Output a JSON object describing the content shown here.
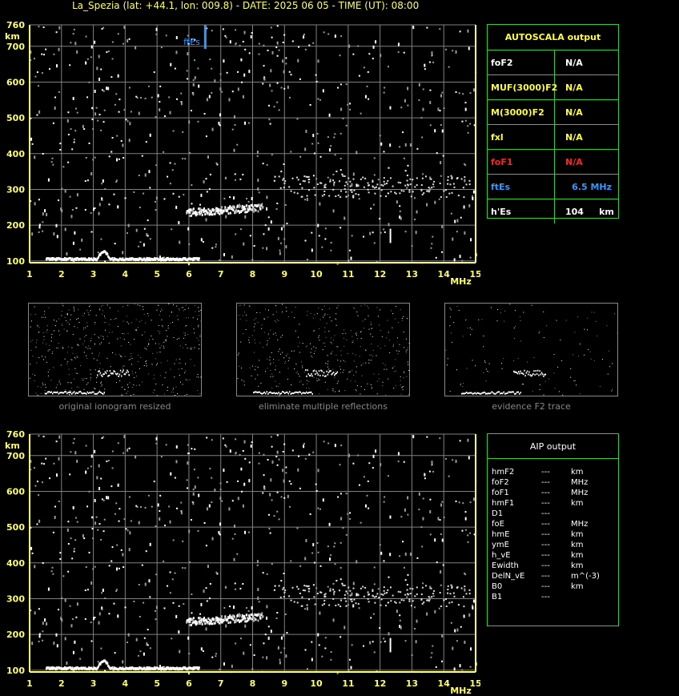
{
  "header": {
    "title": "La_Spezia (lat: +44.1, lon: 009.8) - DATE: 2025 06 05 - TIME (UT): 08:00"
  },
  "colors": {
    "axis": "#ffff66",
    "grid": "#808080",
    "panel_border": "#33cc33",
    "label_yellow": "#ffff33",
    "foF1_red": "#ff2222",
    "ftEs_blue": "#3399ff"
  },
  "chart_data": [
    {
      "type": "scatter",
      "name_hint": "main ionogram",
      "xlabel": "MHz",
      "ylabel": "km",
      "xlim": [
        1,
        15
      ],
      "ylim": [
        95,
        760
      ],
      "x_ticks": [
        1,
        2,
        3,
        4,
        5,
        6,
        7,
        8,
        9,
        10,
        11,
        12,
        13,
        14,
        15
      ],
      "y_ticks": [
        100,
        200,
        300,
        400,
        500,
        600,
        700,
        760
      ],
      "annotation": {
        "label": "ftEs",
        "x": 6.5
      },
      "traces": [
        {
          "id": "E-layer trace",
          "x_range": [
            1.5,
            6.3
          ],
          "y": 105
        },
        {
          "id": "F-layer trace",
          "x_range": [
            5.9,
            8.3
          ],
          "y": 235
        },
        {
          "id": "scattered high echoes",
          "x_range": [
            8.8,
            14.8
          ],
          "y": 310
        }
      ]
    },
    {
      "type": "scatter",
      "name_hint": "bottom ionogram",
      "xlabel": "MHz",
      "ylabel": "km",
      "xlim": [
        1,
        15
      ],
      "ylim": [
        95,
        760
      ],
      "x_ticks": [
        1,
        2,
        3,
        4,
        5,
        6,
        7,
        8,
        9,
        10,
        11,
        12,
        13,
        14,
        15
      ],
      "y_ticks": [
        100,
        200,
        300,
        400,
        500,
        600,
        700,
        760
      ]
    }
  ],
  "autoscala": {
    "title": "AUTOSCALA output",
    "rows": [
      {
        "label": "foF2",
        "value": "N/A"
      },
      {
        "label": "MUF(3000)F2",
        "value": "N/A"
      },
      {
        "label": "M(3000)F2",
        "value": "N/A"
      },
      {
        "label": "fxl",
        "value": "N/A"
      },
      {
        "label": "foF1",
        "value": "N/A"
      },
      {
        "label": "ftEs",
        "value": "6.5 MHz"
      },
      {
        "label": "h'Es",
        "value": "104     km"
      }
    ]
  },
  "thumbnails": [
    {
      "caption": "original ionogram resized"
    },
    {
      "caption": "eliminate multiple reflections"
    },
    {
      "caption": "evidence F2 trace"
    }
  ],
  "aip": {
    "title": "AIP output",
    "rows": [
      {
        "k": "hmF2",
        "d": "---",
        "u": "km"
      },
      {
        "k": "foF2",
        "d": "---",
        "u": "MHz"
      },
      {
        "k": "foF1",
        "d": "---",
        "u": "MHz"
      },
      {
        "k": "hmF1",
        "d": "---",
        "u": "km"
      },
      {
        "k": "D1",
        "d": "---",
        "u": ""
      },
      {
        "k": "foE",
        "d": "---",
        "u": "MHz"
      },
      {
        "k": "hmE",
        "d": "---",
        "u": "km"
      },
      {
        "k": "ymE",
        "d": "---",
        "u": "km"
      },
      {
        "k": "h_vE",
        "d": "---",
        "u": "km"
      },
      {
        "k": "Ewidth",
        "d": "---",
        "u": "km"
      },
      {
        "k": "DelN_vE",
        "d": "---",
        "u": "m^(-3)"
      },
      {
        "k": "B0",
        "d": "---",
        "u": "km"
      },
      {
        "k": "B1",
        "d": "---",
        "u": ""
      }
    ]
  }
}
